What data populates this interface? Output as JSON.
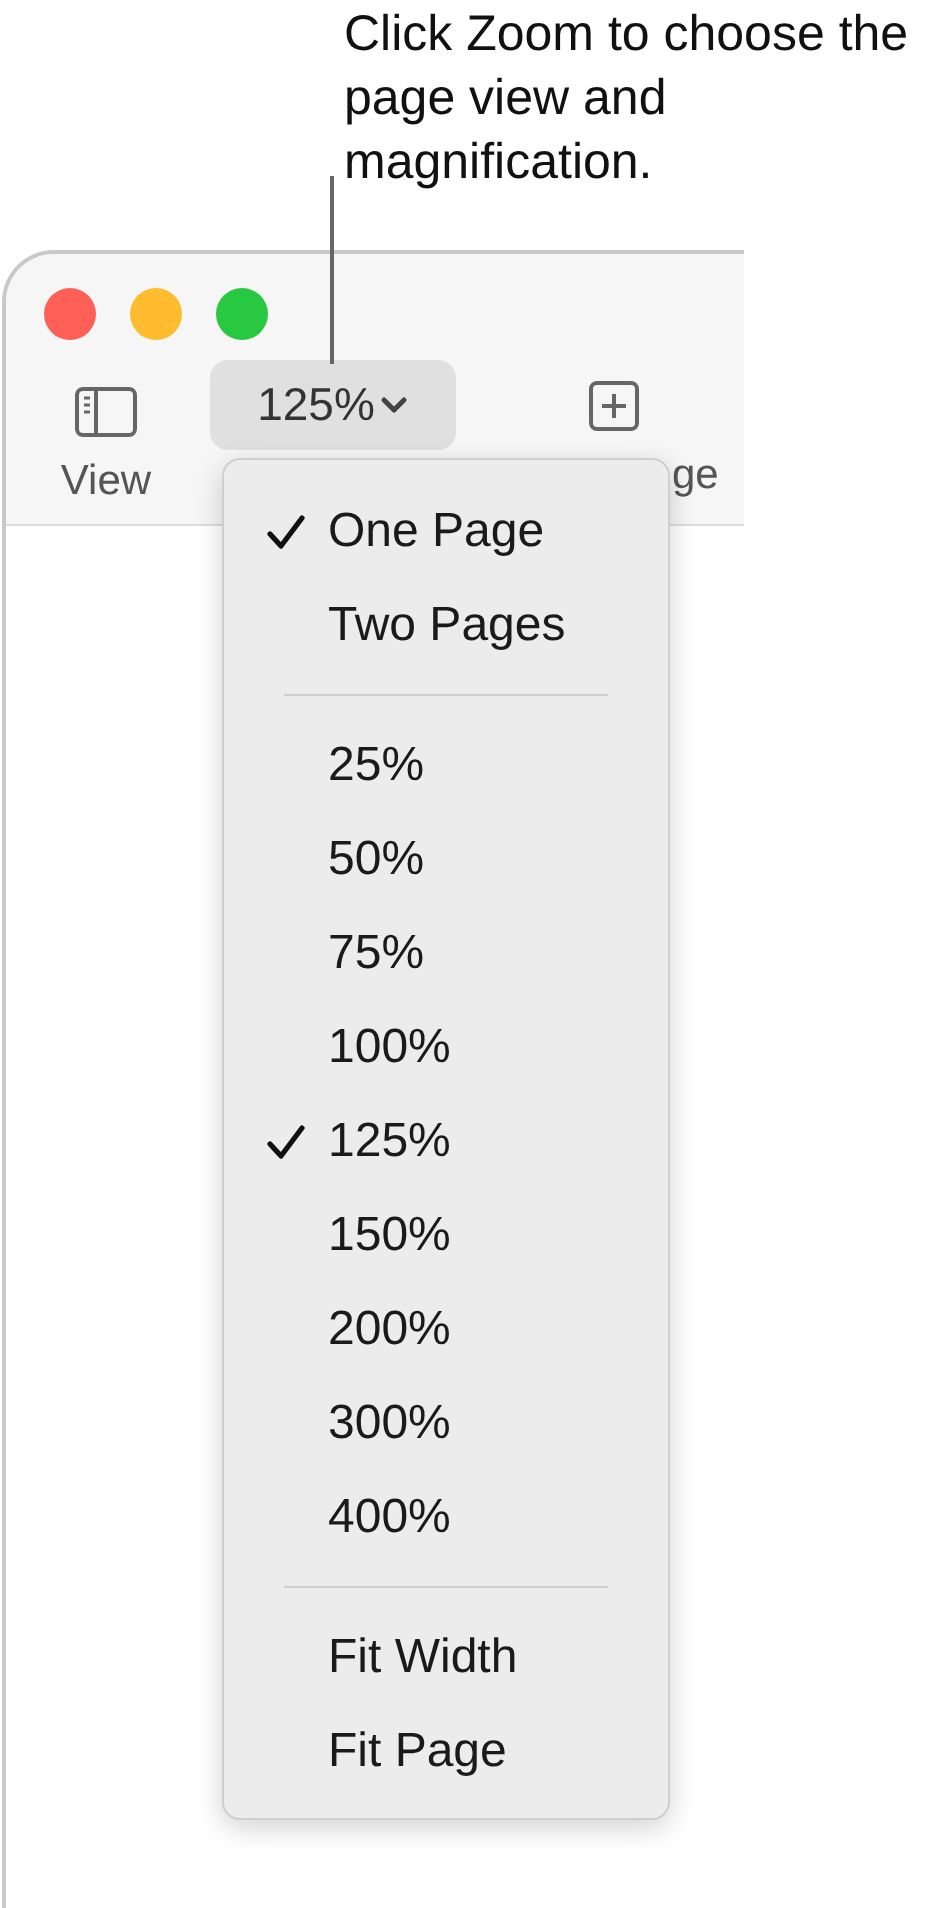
{
  "callout": {
    "text": "Click Zoom to choose the page view and magnification."
  },
  "toolbar": [
    {
      "kind": "sidebar",
      "label": "View"
    },
    {
      "kind": "zoom",
      "value": "125%"
    },
    {
      "kind": "add",
      "label": "ge"
    }
  ],
  "menu": {
    "sections": [
      [
        {
          "label": "One Page",
          "selected": true
        },
        {
          "label": "Two Pages",
          "selected": false
        }
      ],
      [
        {
          "label": "25%",
          "selected": false
        },
        {
          "label": "50%",
          "selected": false
        },
        {
          "label": "75%",
          "selected": false
        },
        {
          "label": "100%",
          "selected": false
        },
        {
          "label": "125%",
          "selected": true
        },
        {
          "label": "150%",
          "selected": false
        },
        {
          "label": "200%",
          "selected": false
        },
        {
          "label": "300%",
          "selected": false
        },
        {
          "label": "400%",
          "selected": false
        }
      ],
      [
        {
          "label": "Fit Width",
          "selected": false
        },
        {
          "label": "Fit Page",
          "selected": false
        }
      ]
    ]
  }
}
